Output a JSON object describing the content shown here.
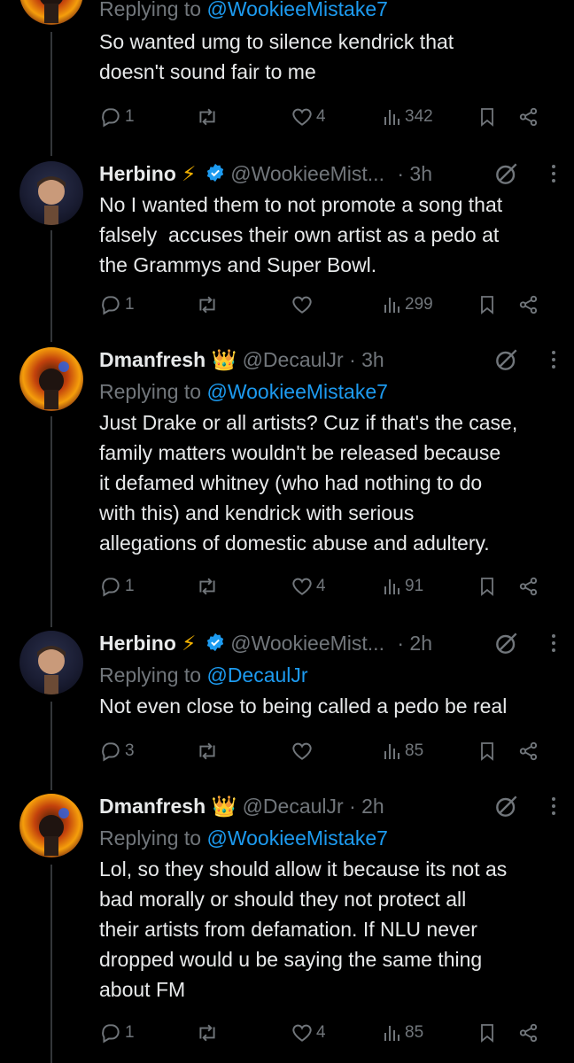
{
  "colors": {
    "background": "#000000",
    "text": "#e7e9ea",
    "muted": "#71767b",
    "link": "#1d9bf0",
    "verified": "#1d9bf0"
  },
  "posts": [
    {
      "reply_prefix": "Replying to",
      "reply_handle": "@WookieeMistake7",
      "text": [
        "So wanted umg to silence kendrick that",
        "doesn't sound fair to me"
      ],
      "replies": "1",
      "likes": "4",
      "views": "342"
    },
    {
      "name": "Herbino",
      "name_emoji": "⚡",
      "handle": "@WookieeMist...",
      "time": "· 3h",
      "text": [
        "No I wanted them to not promote a song that",
        "falsely  accuses their own artist as a pedo at",
        "the Grammys and Super Bowl."
      ],
      "replies": "1",
      "likes": "",
      "views": "299"
    },
    {
      "name": "Dmanfresh",
      "name_emoji": "👑",
      "handle": "@DecaulJr",
      "time": "· 3h",
      "reply_prefix": "Replying to",
      "reply_handle": "@WookieeMistake7",
      "text": [
        "Just Drake or all artists? Cuz if that's the case,",
        "family matters wouldn't be released because",
        "it defamed whitney (who had nothing to do",
        "with this) and kendrick with serious",
        "allegations of domestic abuse and adultery."
      ],
      "replies": "1",
      "likes": "4",
      "views": "91"
    },
    {
      "name": "Herbino",
      "name_emoji": "⚡",
      "handle": "@WookieeMist...",
      "time": "· 2h",
      "reply_prefix": "Replying to",
      "reply_handle": "@DecaulJr",
      "text": [
        "Not even close to being called a pedo be real"
      ],
      "replies": "3",
      "likes": "",
      "views": "85"
    },
    {
      "name": "Dmanfresh",
      "name_emoji": "👑",
      "handle": "@DecaulJr",
      "time": "· 2h",
      "reply_prefix": "Replying to",
      "reply_handle": "@WookieeMistake7",
      "text": [
        "Lol, so they should allow it because its not as",
        "bad morally or should they not protect all",
        "their artists from defamation. If NLU never",
        "dropped would u be saying the same thing",
        "about FM"
      ],
      "replies": "1",
      "likes": "4",
      "views": "85"
    }
  ]
}
